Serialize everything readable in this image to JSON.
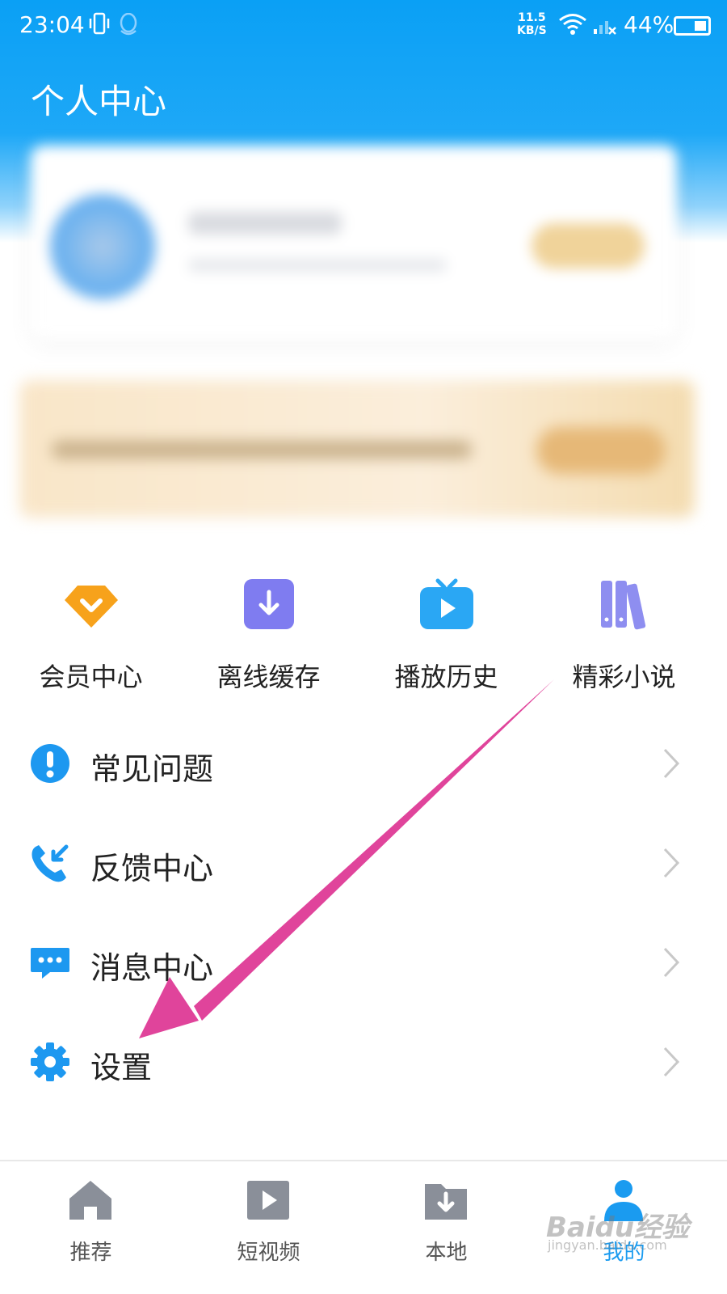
{
  "status_bar": {
    "time": "23:04",
    "net_speed_value": "11.5",
    "net_speed_unit": "KB/S",
    "battery": "44%"
  },
  "header": {
    "title": "个人中心"
  },
  "quick_actions": [
    {
      "label": "会员中心",
      "icon": "diamond-icon",
      "color": "#f7a21b"
    },
    {
      "label": "离线缓存",
      "icon": "download-icon",
      "color": "#7f7cf0"
    },
    {
      "label": "播放历史",
      "icon": "tv-play-icon",
      "color": "#2aa7f4"
    },
    {
      "label": "精彩小说",
      "icon": "books-icon",
      "color": "#8e8ef0"
    }
  ],
  "menu": [
    {
      "label": "常见问题",
      "icon": "exclamation-circle-icon"
    },
    {
      "label": "反馈中心",
      "icon": "phone-callback-icon"
    },
    {
      "label": "消息中心",
      "icon": "chat-bubble-icon"
    },
    {
      "label": "设置",
      "icon": "gear-icon"
    }
  ],
  "tabbar": [
    {
      "label": "推荐",
      "icon": "home-icon",
      "active": false
    },
    {
      "label": "短视频",
      "icon": "video-play-icon",
      "active": false
    },
    {
      "label": "本地",
      "icon": "folder-download-icon",
      "active": false
    },
    {
      "label": "我的",
      "icon": "user-icon",
      "active": true
    }
  ],
  "watermark": {
    "main": "Baidu经验",
    "sub": "jingyan.baidu.com"
  },
  "colors": {
    "accent": "#1a9bf0",
    "annotation_arrow": "#e0449b"
  }
}
